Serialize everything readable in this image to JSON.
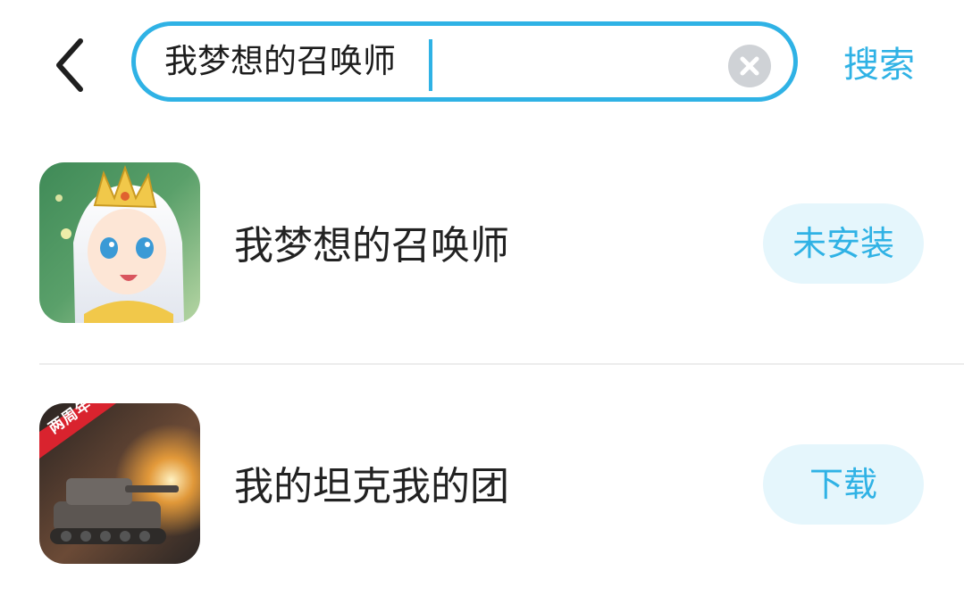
{
  "search": {
    "query": "我梦想的召唤师",
    "submit_label": "搜索"
  },
  "icons": {
    "back": "chevron-left-icon",
    "clear": "clear-circle-icon"
  },
  "colors": {
    "accent": "#2fb2e5",
    "pill_background": "#e5f6fc",
    "clear_button": "#cfd2d6",
    "text_primary": "#222222"
  },
  "results": [
    {
      "name": "我梦想的召唤师",
      "action_label": "未安装"
    },
    {
      "name": "我的坦克我的团",
      "action_label": "下载",
      "icon_badge": "两周年"
    }
  ]
}
